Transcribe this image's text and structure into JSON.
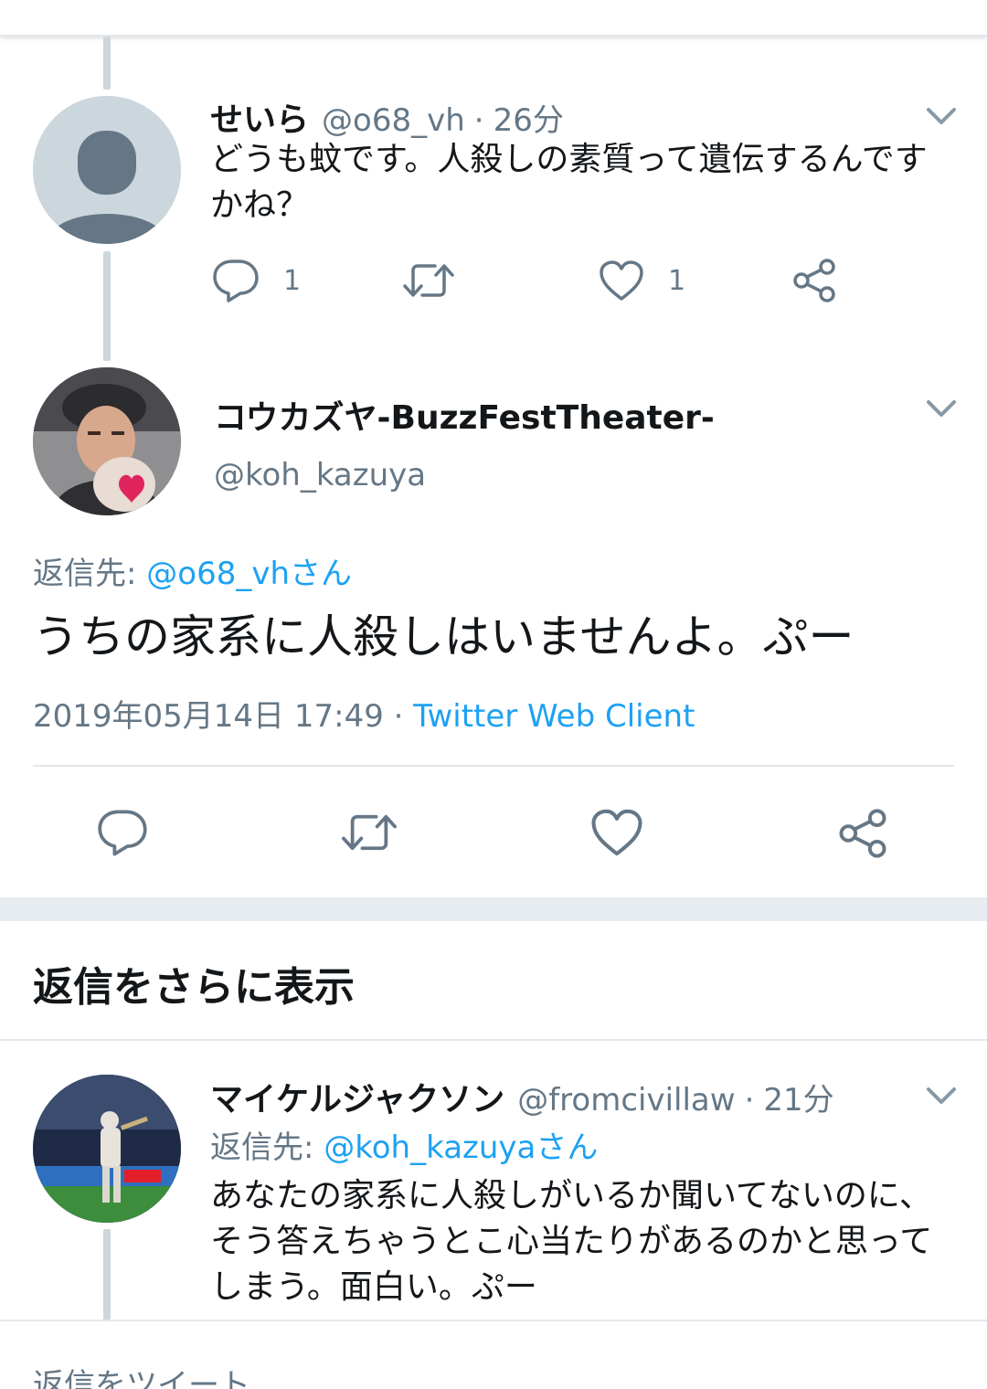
{
  "tweet1": {
    "name": "せいら",
    "handle": "@o68_vh",
    "sep": "·",
    "time": "26分",
    "text": "どうも蚊です。人殺しの素質って遺伝するんですかね？",
    "reply_count": "1",
    "like_count": "1"
  },
  "tweet2": {
    "name": "コウカズヤ-BuzzFestTheater-",
    "handle": "@koh_kazuya",
    "reply_to_label": "返信先:",
    "reply_to_user": "@o68_vhさん",
    "text": "うちの家系に人殺しはいませんよ。ぷー",
    "datetime": "2019年05月14日 17:49",
    "sep": "·",
    "client": "Twitter Web Client"
  },
  "show_more": {
    "label": "返信をさらに表示"
  },
  "tweet3": {
    "name": "マイケルジャクソン",
    "handle": "@fromcivillaw",
    "sep": "·",
    "time": "21分",
    "reply_to_label": "返信先:",
    "reply_to_user": "@koh_kazuyaさん",
    "text": "あなたの家系に人殺しがいるか聞いてないのに、そう答えちゃうとこ心当たりがあるのかと思ってしまう。面白い。ぷー"
  },
  "compose": {
    "placeholder": "返信をツイート"
  },
  "colors": {
    "link": "#1da1f2",
    "secondary": "#657786",
    "thread_line": "#ccd6dd",
    "heart": "#e0245e"
  },
  "icons": [
    "reply-icon",
    "retweet-icon",
    "like-icon",
    "share-icon",
    "chevron-down-icon",
    "default-avatar-icon"
  ]
}
